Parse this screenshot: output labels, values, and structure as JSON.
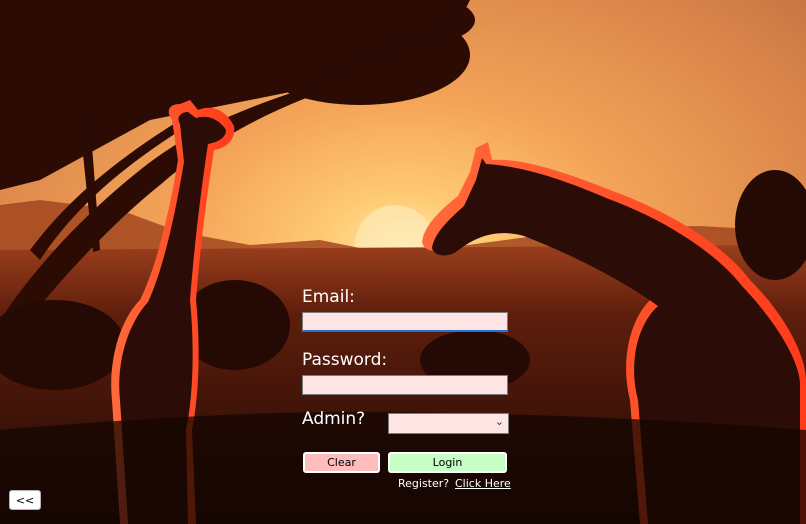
{
  "background": {
    "sky_color": "#f0a050",
    "sun_color": "#ffe7a8",
    "ground_color": "#2a0d05"
  },
  "form": {
    "email_label": "Email:",
    "email_value": "",
    "password_label": "Password:",
    "password_value": "",
    "admin_label": "Admin?",
    "admin_selected": "",
    "field_bg": "#ffe4e4"
  },
  "buttons": {
    "clear_label": "Clear",
    "clear_color": "#ffbcbc",
    "login_label": "Login",
    "login_color": "#c5ffc5",
    "back_label": "<<"
  },
  "register": {
    "prompt": "Register?",
    "link": "Click Here"
  },
  "icons": {
    "dropdown": "chevron-down-icon"
  }
}
